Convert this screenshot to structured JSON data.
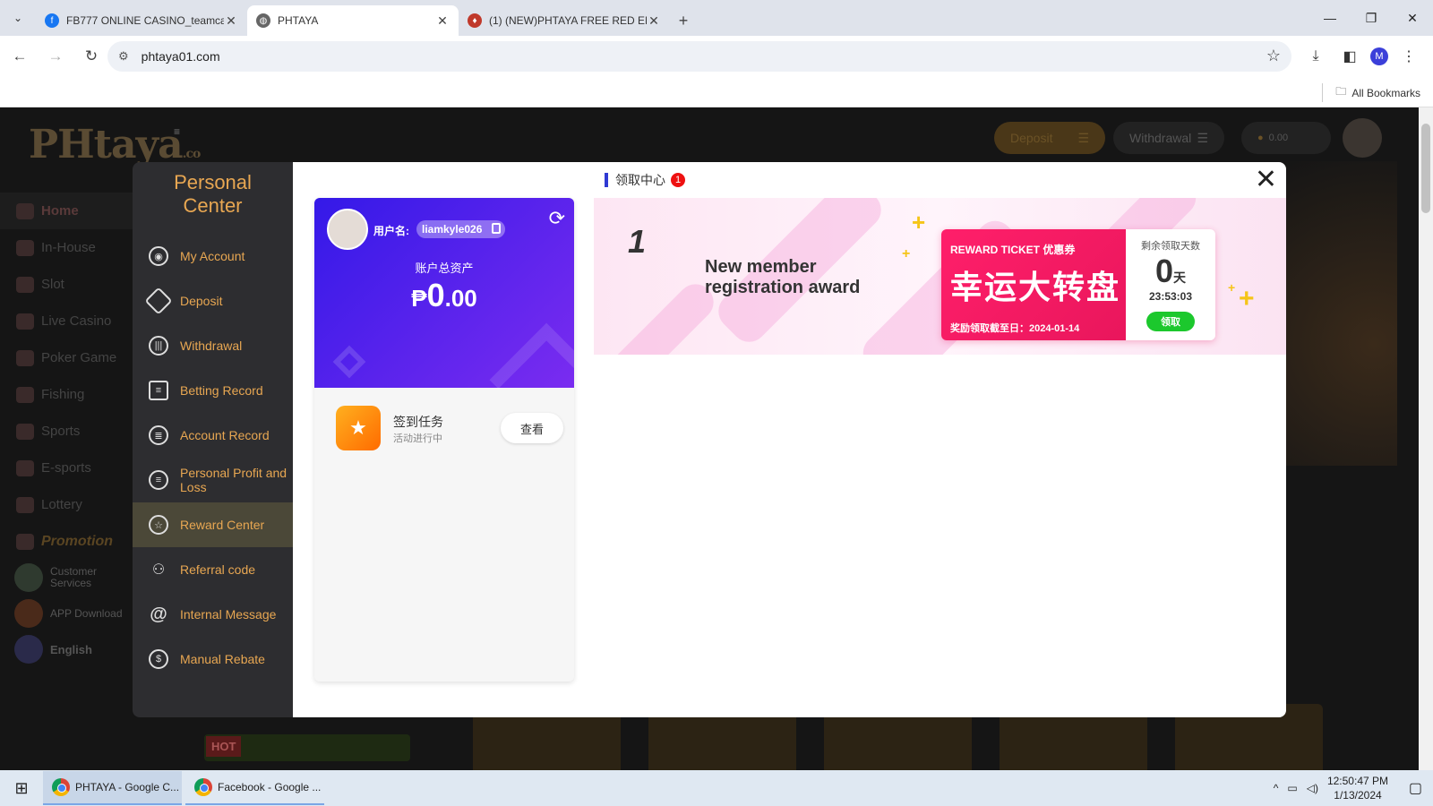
{
  "browser": {
    "tabs": [
      {
        "title": "FB777 ONLINE CASINO_teamca",
        "icon": "facebook-icon",
        "color": "#1877f2",
        "active": false
      },
      {
        "title": "PHTAYA",
        "icon": "globe-icon",
        "color": "#555555",
        "active": true
      },
      {
        "title": "(1) (NEW)PHTAYA FREE RED EN",
        "icon": "site-icon",
        "color": "#c0392b",
        "active": false
      }
    ],
    "url": "phtaya01.com",
    "all_bookmarks": "All Bookmarks",
    "profile_initial": "M"
  },
  "site": {
    "logo": "Htaya",
    "logo_suffix": ".co",
    "nav": [
      {
        "label": "Home"
      },
      {
        "label": "In-House"
      },
      {
        "label": "Slot"
      },
      {
        "label": "Live Casino"
      },
      {
        "label": "Poker Game"
      },
      {
        "label": "Fishing"
      },
      {
        "label": "Sports"
      },
      {
        "label": "E-sports"
      },
      {
        "label": "Lottery"
      }
    ],
    "promotion": "Promotion",
    "customer_services": "Customer Services",
    "app_download": "APP Download",
    "language": "English",
    "deposit": "Deposit",
    "withdrawal": "Withdrawal",
    "balance": "0.00",
    "hot": "HOT"
  },
  "personal_center": {
    "title": "Personal Center",
    "menu": [
      {
        "label": "My Account",
        "icon": "account-icon"
      },
      {
        "label": "Deposit",
        "icon": "deposit-icon"
      },
      {
        "label": "Withdrawal",
        "icon": "withdrawal-icon"
      },
      {
        "label": "Betting Record",
        "icon": "clipboard-icon"
      },
      {
        "label": "Account Record",
        "icon": "list-icon"
      },
      {
        "label": "Personal Profit and Loss",
        "icon": "profit-icon"
      },
      {
        "label": "Reward Center",
        "icon": "star-icon"
      },
      {
        "label": "Referral code",
        "icon": "referral-icon"
      },
      {
        "label": "Internal Message",
        "icon": "at-icon"
      },
      {
        "label": "Manual Rebate",
        "icon": "rebate-icon"
      }
    ],
    "active_item": "Reward Center"
  },
  "account_card": {
    "username_label": "用户名:",
    "username": "liamkyle026",
    "total_assets_label": "账户总资产",
    "currency": "₱",
    "amount_int": "0",
    "amount_dec": ".00",
    "task_name": "签到任务",
    "task_status": "活动进行中",
    "view_label": "查看"
  },
  "reward": {
    "header": "领取中心",
    "badge": "1",
    "number": "1",
    "award_title": "New member registration award",
    "ticket_label": "REWARD TICKET 优惠券",
    "ticket_name": "幸运大转盘",
    "deadline": "奖励领取截至日：2024-01-14",
    "remaining_label": "剩余领取天数",
    "days": "0",
    "days_unit": "天",
    "countdown": "23:53:03",
    "claim_label": "领取"
  },
  "taskbar": {
    "apps": [
      {
        "label": "PHTAYA - Google C...",
        "active": true
      },
      {
        "label": "Facebook - Google ...",
        "active": false
      }
    ],
    "time": "12:50:47 PM",
    "date": "1/13/2024"
  }
}
